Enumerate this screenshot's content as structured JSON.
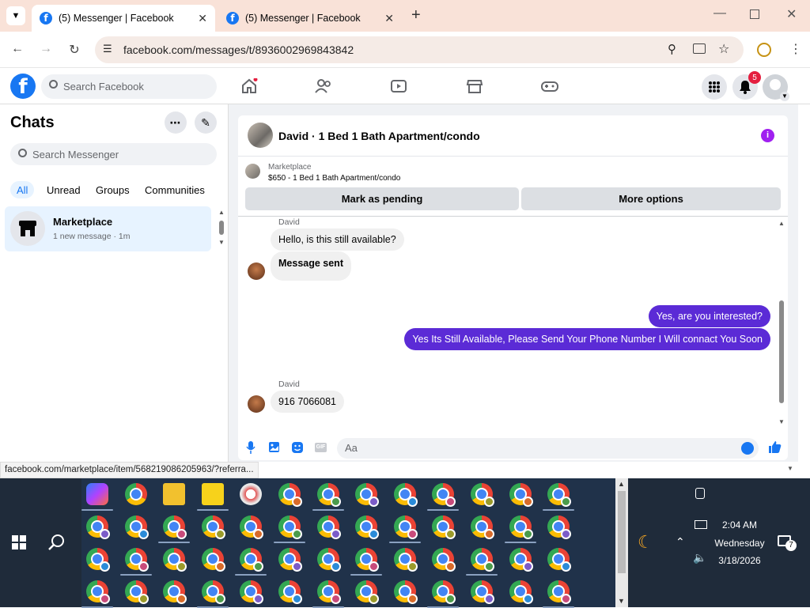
{
  "browser": {
    "tabs": [
      {
        "title": "(5) Messenger | Facebook",
        "active": true
      },
      {
        "title": "(5) Messenger | Facebook",
        "active": false
      }
    ],
    "url": "facebook.com/messages/t/8936002969843842",
    "status_link": "facebook.com/marketplace/item/568219086205963/?referra..."
  },
  "fb_header": {
    "search_placeholder": "Search Facebook",
    "notification_count": "5"
  },
  "sidebar": {
    "title": "Chats",
    "search_placeholder": "Search Messenger",
    "filters": [
      "All",
      "Unread",
      "Groups",
      "Communities"
    ],
    "active_filter": "All",
    "chats": [
      {
        "name": "Marketplace",
        "preview": "1 new message · 1m"
      }
    ]
  },
  "conversation": {
    "header_title": "David · 1 Bed 1 Bath Apartment/condo",
    "listing": {
      "source": "Marketplace",
      "summary": "$650 - 1 Bed 1 Bath Apartment/condo"
    },
    "actions": {
      "mark_pending": "Mark as pending",
      "more_options": "More options"
    },
    "messages": [
      {
        "sender": "David",
        "text": "Hello, is this still available?",
        "dir": "in"
      },
      {
        "text": "Message sent",
        "dir": "in",
        "bold": true
      },
      {
        "text": "Yes, are you interested?",
        "dir": "out"
      },
      {
        "text": "Yes Its Still Available, Please Send Your Phone Number I Will connact You Soon",
        "dir": "out"
      },
      {
        "sender": "David",
        "text": "916 7066081",
        "dir": "in"
      }
    ],
    "composer_placeholder": "Aa"
  },
  "taskbar": {
    "time": "2:04 AM",
    "day": "Wednesday",
    "date": "3/18/2026",
    "notif_count": "7"
  },
  "colors": {
    "fb_blue": "#1877f2",
    "outgoing_bubble": "#5b2bd6",
    "tab_strip": "#f9e2d8"
  }
}
